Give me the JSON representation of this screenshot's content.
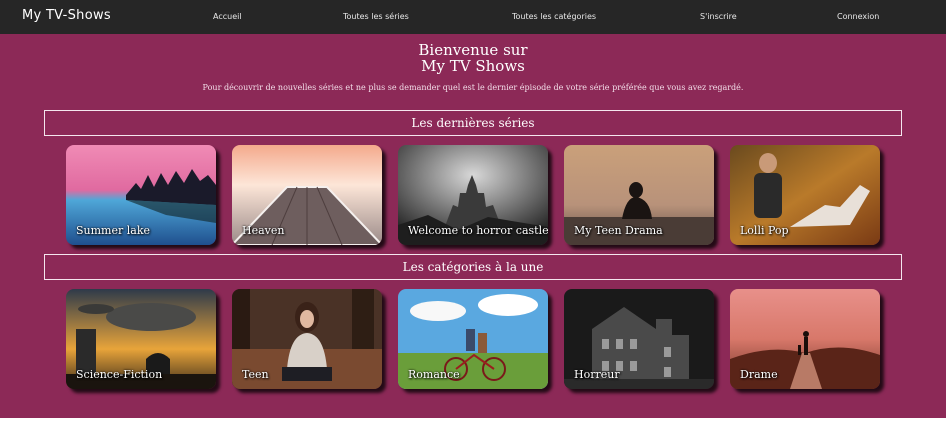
{
  "navbar": {
    "brand": "My TV-Shows",
    "links": [
      "Accueil",
      "Toutes les séries",
      "Toutes les catégories",
      "S'inscrire",
      "Connexion"
    ]
  },
  "hero": {
    "title_line1": "Bienvenue sur",
    "title_line2": "My TV Shows",
    "subtitle": "Pour découvrir de nouvelles séries et ne plus se demander quel est le dernier épisode de votre série préférée que vous avez regardé."
  },
  "latest_series": {
    "heading": "Les dernières séries",
    "items": [
      {
        "title": "Summer lake",
        "image": "lake-sunset-image"
      },
      {
        "title": "Heaven",
        "image": "pier-sky-image"
      },
      {
        "title": "Welcome to horror castle",
        "image": "dark-castle-image"
      },
      {
        "title": "My Teen Drama",
        "image": "sad-girl-dock-image"
      },
      {
        "title": "Lolli Pop",
        "image": "couple-autumn-image"
      }
    ]
  },
  "featured_categories": {
    "heading": "Les catégories à la une",
    "items": [
      {
        "title": "Science-Fiction",
        "image": "spaceship-city-image"
      },
      {
        "title": "Teen",
        "image": "girl-leaves-image"
      },
      {
        "title": "Romance",
        "image": "couple-bicycle-image"
      },
      {
        "title": "Horreur",
        "image": "haunted-house-image"
      },
      {
        "title": "Drame",
        "image": "sunset-walk-image"
      }
    ]
  },
  "colors": {
    "navbar_bg": "#262626",
    "main_bg": "#8c2957",
    "text": "#ffffff"
  }
}
